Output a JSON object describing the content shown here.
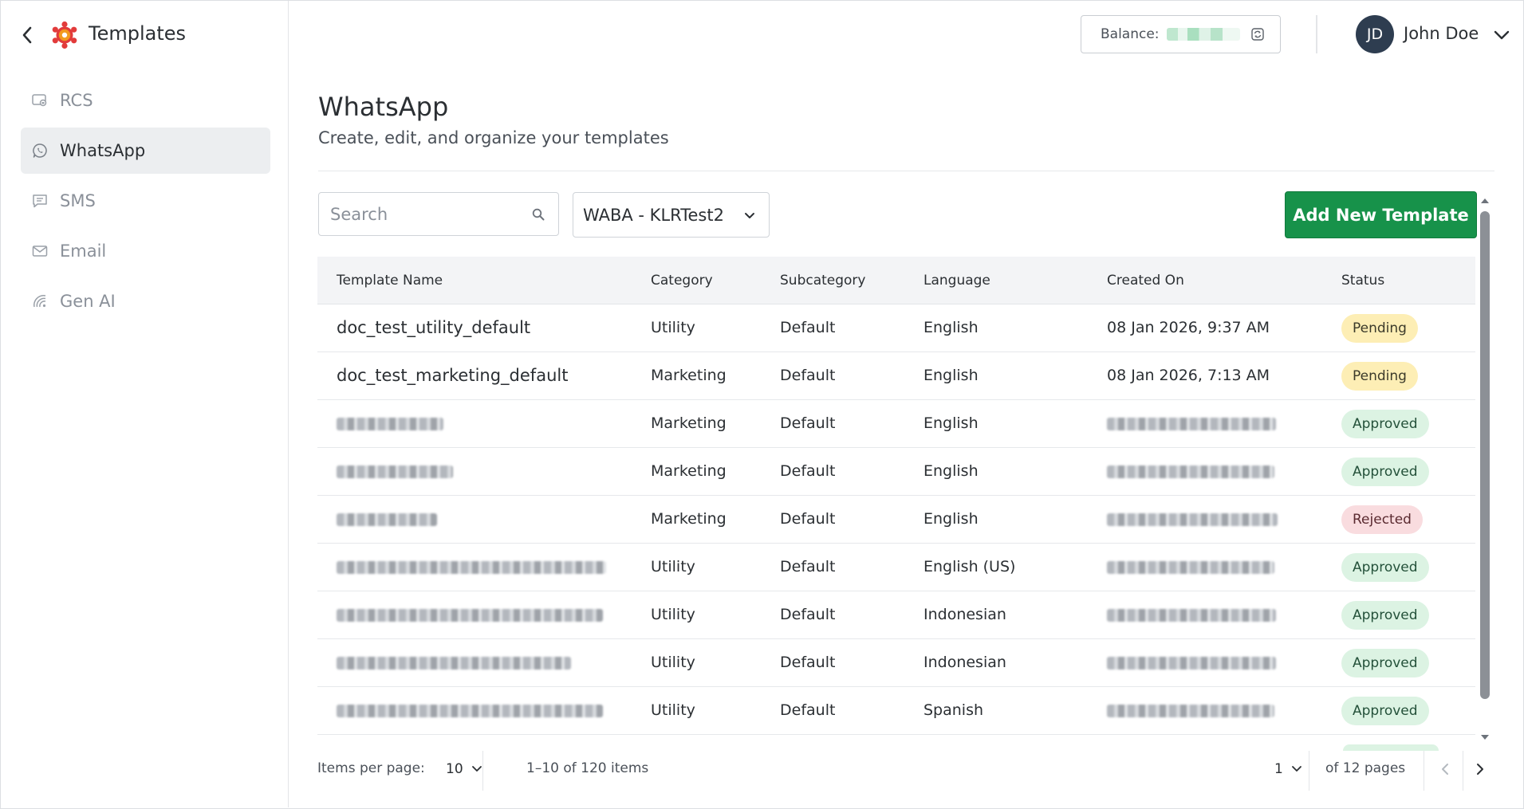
{
  "app": {
    "title": "Templates"
  },
  "sidebar": {
    "items": [
      {
        "label": "RCS",
        "icon": "rcs-icon",
        "active": false
      },
      {
        "label": "WhatsApp",
        "icon": "whatsapp-icon",
        "active": true
      },
      {
        "label": "SMS",
        "icon": "sms-icon",
        "active": false
      },
      {
        "label": "Email",
        "icon": "email-icon",
        "active": false
      },
      {
        "label": "Gen AI",
        "icon": "gen-ai-icon",
        "active": false
      }
    ]
  },
  "header": {
    "balance_label": "Balance:",
    "user_initials": "JD",
    "user_name": "John Doe"
  },
  "main": {
    "title": "WhatsApp",
    "subtitle": "Create, edit, and organize your templates",
    "search_placeholder": "Search",
    "waba_selected": "WABA - KLRTest2",
    "add_button_label": "Add New Template"
  },
  "table": {
    "columns": [
      "Template Name",
      "Category",
      "Subcategory",
      "Language",
      "Created On",
      "Status"
    ],
    "rows": [
      {
        "name": "doc_test_utility_default",
        "category": "Utility",
        "subcategory": "Default",
        "language": "English",
        "created_on": "08 Jan 2026, 9:37 AM",
        "status": "Pending"
      },
      {
        "name": "doc_test_marketing_default",
        "category": "Marketing",
        "subcategory": "Default",
        "language": "English",
        "created_on": "08 Jan 2026, 7:13 AM",
        "status": "Pending"
      },
      {
        "name": "",
        "category": "Marketing",
        "subcategory": "Default",
        "language": "English",
        "created_on": "",
        "status": "Approved"
      },
      {
        "name": "",
        "category": "Marketing",
        "subcategory": "Default",
        "language": "English",
        "created_on": "",
        "status": "Approved"
      },
      {
        "name": "",
        "category": "Marketing",
        "subcategory": "Default",
        "language": "English",
        "created_on": "",
        "status": "Rejected"
      },
      {
        "name": "",
        "category": "Utility",
        "subcategory": "Default",
        "language": "English (US)",
        "created_on": "",
        "status": "Approved"
      },
      {
        "name": "",
        "category": "Utility",
        "subcategory": "Default",
        "language": "Indonesian",
        "created_on": "",
        "status": "Approved"
      },
      {
        "name": "",
        "category": "Utility",
        "subcategory": "Default",
        "language": "Indonesian",
        "created_on": "",
        "status": "Approved"
      },
      {
        "name": "",
        "category": "Utility",
        "subcategory": "Default",
        "language": "Spanish",
        "created_on": "",
        "status": "Approved"
      }
    ]
  },
  "pagination": {
    "items_per_page_label": "Items per page:",
    "items_per_page": "10",
    "range_text": "1–10 of 120 items",
    "current_page": "1",
    "pages_text": "of 12 pages"
  },
  "colors": {
    "primary_green": "#17924a",
    "pending_bg": "#fdeeb5",
    "approved_bg": "#dcf3e3",
    "rejected_bg": "#f9dcdf",
    "avatar_bg": "#2e3d50",
    "logo_red": "#e23b3b",
    "logo_orange": "#f39a1e"
  }
}
